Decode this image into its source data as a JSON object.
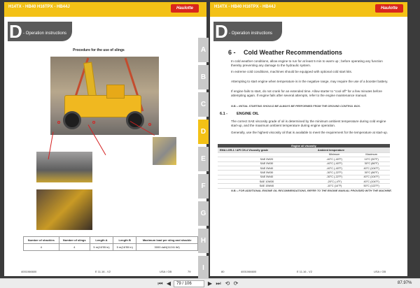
{
  "left_page": {
    "header_models": "H14TX - HB40 H16TPX - HB44J",
    "logo": "Haulotte",
    "chapter_letter": "D",
    "chapter_title": "- Operation instructions",
    "procedure_title": "Procedure for the use of slings",
    "table": {
      "headers": [
        "Number of shackles",
        "Number of slings",
        "Length  A",
        "Length  B",
        "Maximum load per sling and shackle"
      ],
      "rows": [
        [
          "4",
          "4",
          "5 m(16'55 in)",
          "5 m(16'55 in)",
          "3000 daN(11241 lbf)"
        ]
      ]
    },
    "footer": {
      "code": "4001066600",
      "edition": "E 11.16 - V2",
      "lang": "USA / GB",
      "page": "79"
    }
  },
  "right_page": {
    "header_models": "H14TX - HB40 H16TPX - HB44J",
    "logo": "Haulotte",
    "chapter_letter": "D",
    "chapter_title": "- Operation instructions",
    "section_num": "6 -",
    "section_title": "Cold Weather Recommendations",
    "paragraphs": [
      "In cold weather conditions, allow engine to run for at least  5 min to warm up ; before operating any function thereby preventing any damage to the hydraulic system.",
      "In extreme cold conditions, machines should be equipped with optional cold start kits.",
      "Attempting to start engine when temperature is in the negative range, may require the use of a booster battery.",
      "If engine fails to start, do not crank for an extended time. Allow starter to \"cool off\" for a few minutes before attempting again. If engine fails after several attempts, refer to the engine maintenance manual."
    ],
    "note1": "N.B.:- INITIAL STARTING SHOULD BE ALWAYS BE PERFORMED FROM THE GROUND CONTROL BOX.",
    "sub_num": "6.1 -",
    "sub_title": "ENGINE OIL",
    "oil_paragraphs": [
      "The correct  SAE viscosity grade of oil is determined by the minimum ambient temperature during cold engine start-up, and the maximum ambient temperature during engine operation.",
      "Generally, use the highest viscosity oil that is available to meet the requirement for the temperature at start-up."
    ],
    "oil_table": {
      "title": "Engine oil viscosity",
      "col1": "EMA LGR-1 / API CH-4 Viscosity grade",
      "col2": "Ambient temperature",
      "min_label": "Minimum",
      "max_label": "Maximum",
      "rows": [
        [
          "SAE 0W20",
          "-40°C (-40°F)",
          "10°C (50°F)"
        ],
        [
          "SAE 0W30",
          "-40°C (-40°F)",
          "30°C (86°F)"
        ],
        [
          "SAE 0W40",
          "-40°C (-40°F)",
          "40°C (104°F)"
        ],
        [
          "SAE 5W30",
          "-30°C (-22°F)",
          "30°C (86°F)"
        ],
        [
          "SAE 5W40",
          "-30°C (-22°F)",
          "40°C (104°F)"
        ],
        [
          "SAE 10W30",
          "-20°C (-4°F)",
          "40°C (104°F)"
        ],
        [
          "SAE 15W40",
          "-10°C (14°F)",
          "50°C (122°F)"
        ]
      ]
    },
    "note2": "N.B.:- FOR ADDITIONAL ENGINE OIL RECOMMENDATIONS, REFER TO THE ENGINE MANUAL PROVIDED WITH THE MACHINE.",
    "footer": {
      "page": "80",
      "code": "4001066600",
      "edition": "E 11.16 - V2",
      "lang": "USA / GB"
    }
  },
  "tabs": [
    "A",
    "B",
    "C",
    "D",
    "E",
    "F",
    "G",
    "H",
    "I"
  ],
  "active_tab": "D",
  "statusbar": {
    "first": "⏮",
    "prev": "◀",
    "page_input": "79 / 106",
    "next": "▶",
    "last": "⏭",
    "back": "⟲",
    "forward": "⟳",
    "zoom": "87.97%"
  },
  "colors": {
    "accent": "#f3c116",
    "brand_red": "#d9261c",
    "chapter_grey": "#5a5a5a"
  }
}
